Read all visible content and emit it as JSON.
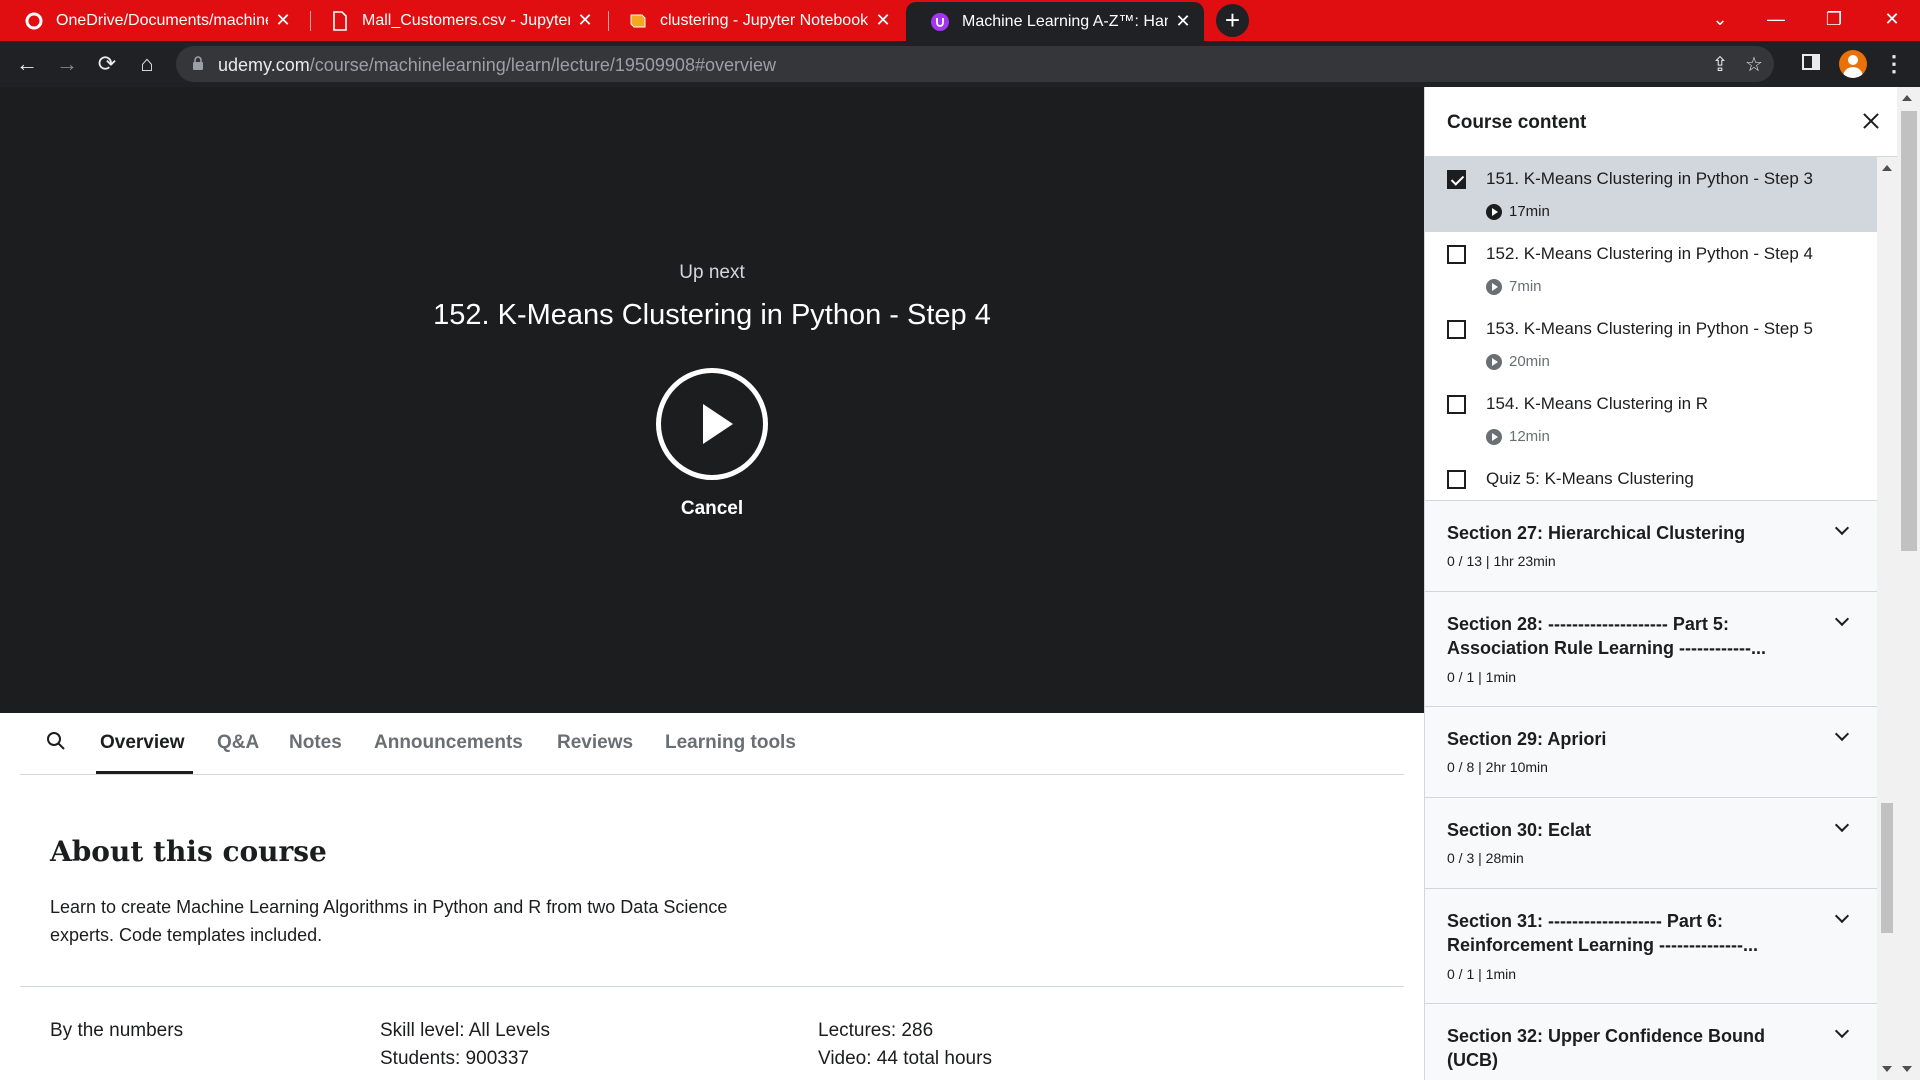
{
  "browser": {
    "tabs": [
      {
        "title": "OneDrive/Documents/machine-le",
        "icon": "onedrive-icon"
      },
      {
        "title": "Mall_Customers.csv - Jupyter Tex",
        "icon": "file-icon"
      },
      {
        "title": "clustering - Jupyter Notebook",
        "icon": "notebook-icon"
      },
      {
        "title": "Machine Learning A-Z™: Hands-O",
        "icon": "udemy-icon"
      }
    ],
    "url_host": "udemy.com",
    "url_path": "/course/machinelearning/learn/lecture/19509908#overview",
    "accent_color": "#e00d11"
  },
  "player": {
    "upnext_label": "Up next",
    "upnext_title": "152. K-Means Clustering in Python - Step 4",
    "cancel_label": "Cancel"
  },
  "lower_tabs": [
    "Overview",
    "Q&A",
    "Notes",
    "Announcements",
    "Reviews",
    "Learning tools"
  ],
  "about": {
    "title": "About this course",
    "text": "Learn to create Machine Learning Algorithms in Python and R from two Data Science experts. Code templates included.",
    "numbers_label": "By the numbers",
    "skill_level": "Skill level: All Levels",
    "students": "Students: 900337",
    "lectures": "Lectures: 286",
    "video": "Video: 44 total hours"
  },
  "sidebar": {
    "title": "Course content",
    "lectures": [
      {
        "title": "151. K-Means Clustering in Python - Step 3",
        "duration": "17min",
        "checked": true
      },
      {
        "title": "152. K-Means Clustering in Python - Step 4",
        "duration": "7min",
        "checked": false
      },
      {
        "title": "153. K-Means Clustering in Python - Step 5",
        "duration": "20min",
        "checked": false
      },
      {
        "title": "154. K-Means Clustering in R",
        "duration": "12min",
        "checked": false
      },
      {
        "title": "Quiz 5: K-Means Clustering",
        "duration": "",
        "checked": false
      }
    ],
    "sections": [
      {
        "title": "Section 27: Hierarchical Clustering",
        "meta": "0 / 13 | 1hr 23min"
      },
      {
        "title": "Section 28: -------------------- Part 5: Association Rule Learning ------------...",
        "meta": "0 / 1 | 1min"
      },
      {
        "title": "Section 29: Apriori",
        "meta": "0 / 8 | 2hr 10min"
      },
      {
        "title": "Section 30: Eclat",
        "meta": "0 / 3 | 28min"
      },
      {
        "title": "Section 31: ------------------- Part 6: Reinforcement Learning --------------...",
        "meta": "0 / 1 | 1min"
      },
      {
        "title": "Section 32: Upper Confidence Bound (UCB)",
        "meta": ""
      }
    ]
  }
}
